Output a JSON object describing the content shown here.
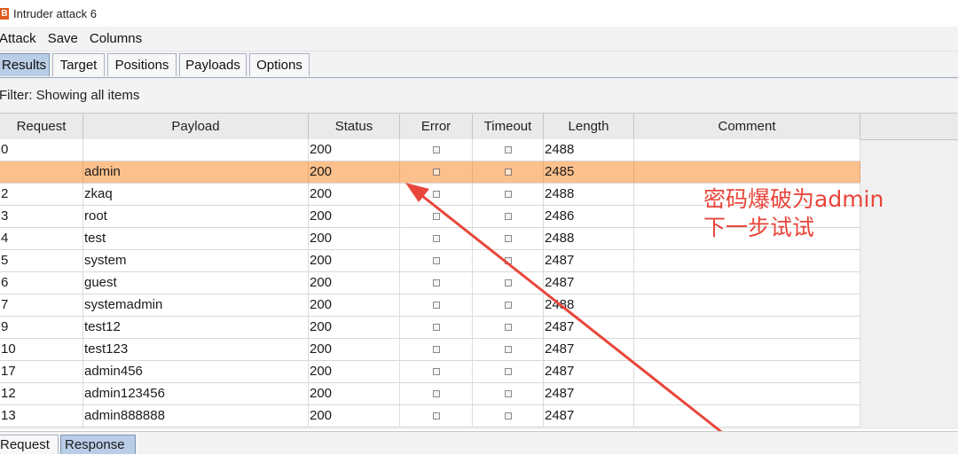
{
  "window": {
    "title": "Intruder attack 6",
    "icon_letter": "B"
  },
  "menu": [
    "Attack",
    "Save",
    "Columns"
  ],
  "tabs": [
    {
      "label": "Results",
      "active": true
    },
    {
      "label": "Target",
      "active": false
    },
    {
      "label": "Positions",
      "active": false
    },
    {
      "label": "Payloads",
      "active": false
    },
    {
      "label": "Options",
      "active": false
    }
  ],
  "filter": {
    "text": "Filter: Showing all items"
  },
  "table": {
    "columns": [
      "Request",
      "Payload",
      "Status",
      "Error",
      "Timeout",
      "Length",
      "Comment"
    ],
    "rows": [
      {
        "request": "0",
        "payload": "",
        "status": "200",
        "error": false,
        "timeout": false,
        "length": "2488",
        "comment": "",
        "selected": false
      },
      {
        "request": "",
        "payload": "admin",
        "status": "200",
        "error": false,
        "timeout": false,
        "length": "2485",
        "comment": "",
        "selected": true
      },
      {
        "request": "2",
        "payload": "zkaq",
        "status": "200",
        "error": false,
        "timeout": false,
        "length": "2488",
        "comment": "",
        "selected": false
      },
      {
        "request": "3",
        "payload": "root",
        "status": "200",
        "error": false,
        "timeout": false,
        "length": "2486",
        "comment": "",
        "selected": false
      },
      {
        "request": "4",
        "payload": "test",
        "status": "200",
        "error": false,
        "timeout": false,
        "length": "2488",
        "comment": "",
        "selected": false
      },
      {
        "request": "5",
        "payload": "system",
        "status": "200",
        "error": false,
        "timeout": false,
        "length": "2487",
        "comment": "",
        "selected": false
      },
      {
        "request": "6",
        "payload": "guest",
        "status": "200",
        "error": false,
        "timeout": false,
        "length": "2487",
        "comment": "",
        "selected": false
      },
      {
        "request": "7",
        "payload": "systemadmin",
        "status": "200",
        "error": false,
        "timeout": false,
        "length": "2488",
        "comment": "",
        "selected": false
      },
      {
        "request": "9",
        "payload": "test12",
        "status": "200",
        "error": false,
        "timeout": false,
        "length": "2487",
        "comment": "",
        "selected": false
      },
      {
        "request": "10",
        "payload": "test123",
        "status": "200",
        "error": false,
        "timeout": false,
        "length": "2487",
        "comment": "",
        "selected": false
      },
      {
        "request": "17",
        "payload": "admin456",
        "status": "200",
        "error": false,
        "timeout": false,
        "length": "2487",
        "comment": "",
        "selected": false
      },
      {
        "request": "12",
        "payload": "admin123456",
        "status": "200",
        "error": false,
        "timeout": false,
        "length": "2487",
        "comment": "",
        "selected": false
      },
      {
        "request": "13",
        "payload": "admin888888",
        "status": "200",
        "error": false,
        "timeout": false,
        "length": "2487",
        "comment": "",
        "selected": false
      }
    ]
  },
  "annotation": {
    "line1": "密码爆破为admin",
    "line2": "下一步试试",
    "color": "#e8463a"
  },
  "bottom_tabs": [
    {
      "label": "Request",
      "active": true
    },
    {
      "label": "Response",
      "active": false
    }
  ],
  "colors": {
    "selected_row": "#fcc08c",
    "active_tab": "#b9cde6",
    "arrow": "#e8463a"
  }
}
